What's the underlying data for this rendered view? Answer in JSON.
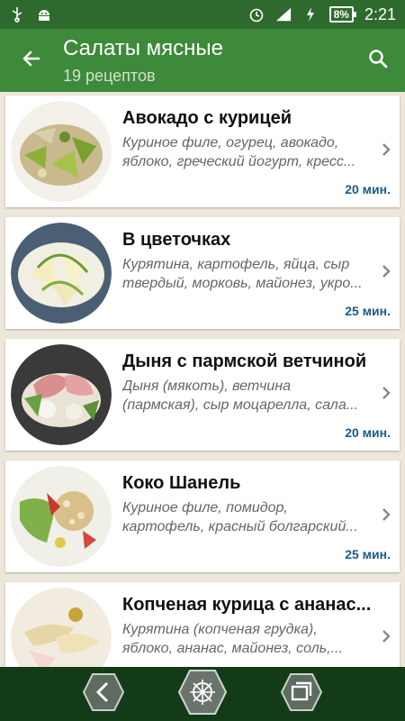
{
  "status_bar": {
    "battery": "8%",
    "time": "2:21"
  },
  "app_bar": {
    "title": "Салаты мясные",
    "subtitle": "19 рецептов"
  },
  "recipes": [
    {
      "title": "Авокадо с курицей",
      "description": "Куриное филе, огурец, авокадо, яблоко, греческий йогурт, кресс...",
      "time": "20 мин."
    },
    {
      "title": "В цветочках",
      "description": "Курятина, картофель, яйца, сыр твердый, морковь, майонез, укро...",
      "time": "25 мин."
    },
    {
      "title": "Дыня с пармской ветчиной",
      "description": "Дыня (мякоть), ветчина (пармская), сыр моцарелла, сала...",
      "time": "20 мин."
    },
    {
      "title": "Коко Шанель",
      "description": "Куриное филе, помидор, картофель, красный болгарский...",
      "time": "25 мин."
    },
    {
      "title": "Копченая курица с ананас...",
      "description": "Курятина (копченая грудка), яблоко, ананас, майонез, соль,...",
      "time": ""
    }
  ],
  "icons": {
    "back": "back-arrow-icon",
    "search": "search-icon",
    "chevron": "chevron-right-icon"
  },
  "colors": {
    "status_bar": "#2e6a2e",
    "app_bar": "#3d8a3a",
    "time_text": "#1d5a8a",
    "nav_bar": "#133b17"
  }
}
